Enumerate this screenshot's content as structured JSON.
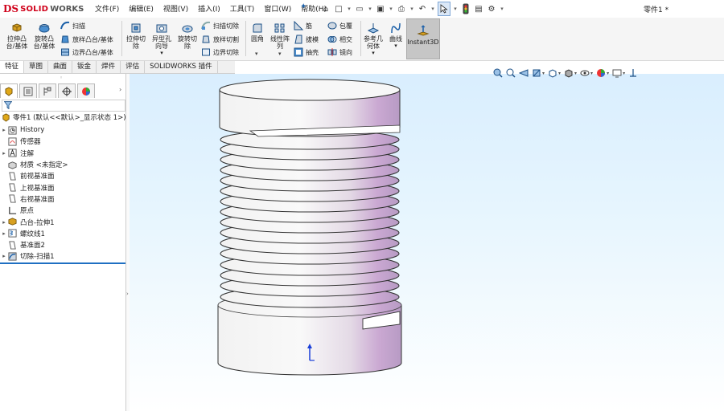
{
  "app": {
    "logo_prefix": "DS",
    "logo_text_a": "SOLID",
    "logo_text_b": "WORKS",
    "document_title": "零件1 *"
  },
  "menu": [
    "文件(F)",
    "编辑(E)",
    "视图(V)",
    "插入(I)",
    "工具(T)",
    "窗口(W)",
    "帮助(H)"
  ],
  "ribbon": {
    "extrude_boss": "拉伸凸\n台/基体",
    "revolve_boss": "旋转凸\n台/基体",
    "sweep": "扫描",
    "loft_boss": "放样凸台/基体",
    "boundary_boss": "边界凸台/基体",
    "extrude_cut": "拉伸切\n除",
    "hole_wizard": "异型孔\n向导",
    "revolve_cut": "旋转切\n除",
    "sweep_cut": "扫描切除",
    "loft_cut": "放样切割",
    "boundary_cut": "边界切除",
    "fillet": "圆角",
    "linear_pattern": "线性阵\n列",
    "rib": "筋",
    "draft": "拔模",
    "shell": "抽壳",
    "wrap": "包覆",
    "intersect": "相交",
    "mirror": "镜向",
    "reference_geometry": "参考几\n何体",
    "curves": "曲线",
    "instant3d": "Instant3D"
  },
  "tabs": [
    {
      "label": "特征",
      "active": true
    },
    {
      "label": "草图",
      "active": false
    },
    {
      "label": "曲面",
      "active": false
    },
    {
      "label": "钣金",
      "active": false
    },
    {
      "label": "焊件",
      "active": false
    },
    {
      "label": "评估",
      "active": false
    },
    {
      "label": "SOLIDWORKS 插件",
      "active": false
    }
  ],
  "tree": {
    "root": "零件1  (默认<<默认>_显示状态 1>)",
    "items": [
      {
        "label": "History",
        "expandable": true,
        "icon": "history-icon"
      },
      {
        "label": "传感器",
        "expandable": false,
        "icon": "sensor-icon"
      },
      {
        "label": "注解",
        "expandable": true,
        "icon": "annotation-icon"
      },
      {
        "label": "材质 <未指定>",
        "expandable": false,
        "icon": "material-icon"
      },
      {
        "label": "前视基准面",
        "expandable": false,
        "icon": "plane-icon"
      },
      {
        "label": "上视基准面",
        "expandable": false,
        "icon": "plane-icon"
      },
      {
        "label": "右视基准面",
        "expandable": false,
        "icon": "plane-icon"
      },
      {
        "label": "原点",
        "expandable": false,
        "icon": "origin-icon"
      },
      {
        "label": "凸台-拉伸1",
        "expandable": true,
        "icon": "extrude-feature-icon"
      },
      {
        "label": "螺纹线1",
        "expandable": true,
        "icon": "helix-icon"
      },
      {
        "label": "基准面2",
        "expandable": false,
        "icon": "plane-icon"
      },
      {
        "label": "切除-扫描1",
        "expandable": true,
        "icon": "sweep-cut-icon"
      }
    ]
  },
  "colors": {
    "accent": "#1f6fc2",
    "ribbon_bg": "#f5f5f5",
    "viewport_top": "#d9eefe",
    "viewport_bottom": "#ffffff",
    "brand_red": "#d0021b"
  }
}
